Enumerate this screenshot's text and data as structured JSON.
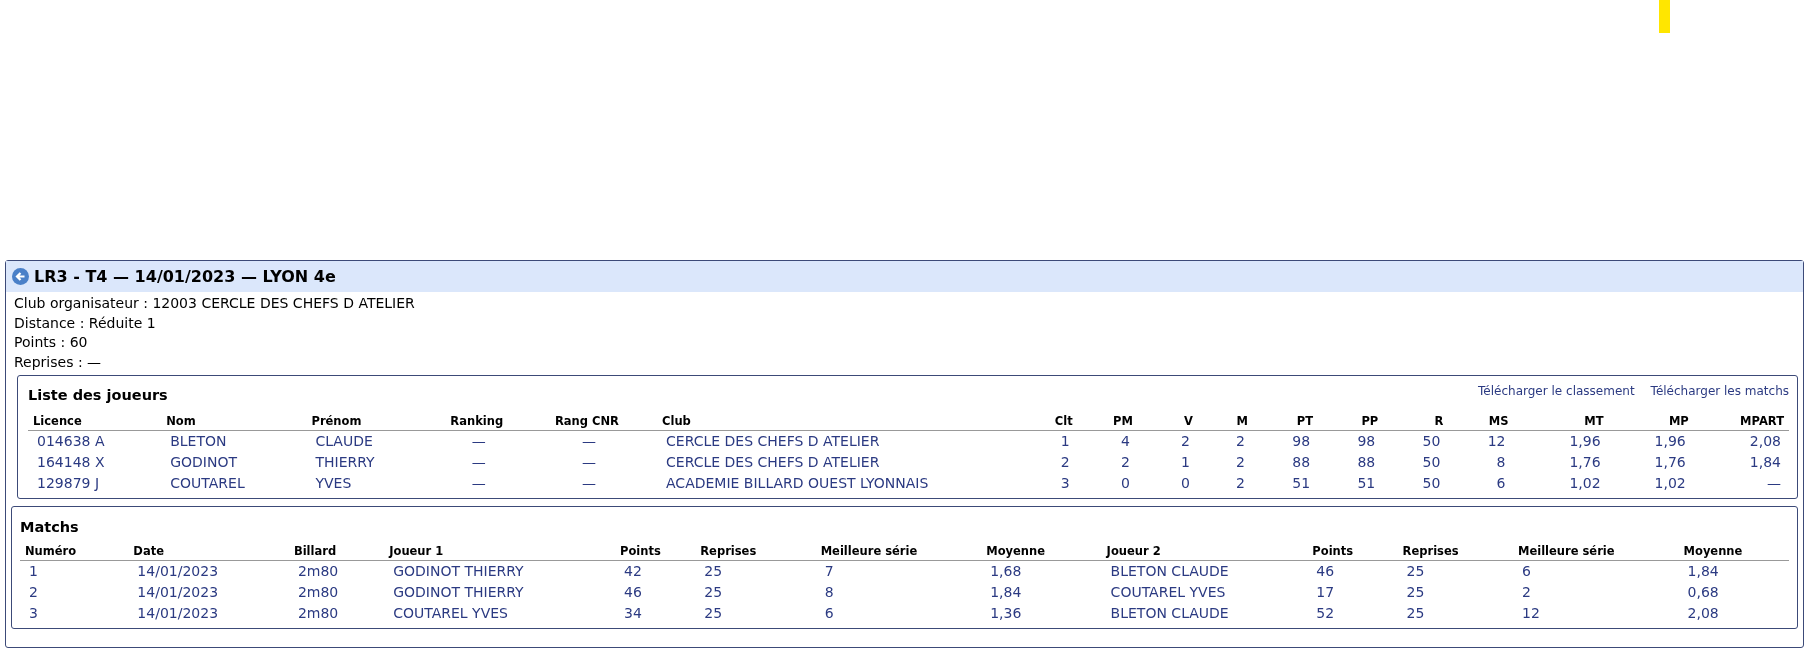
{
  "title": "LR3 - T4 — 14/01/2023 — LYON 4e",
  "info": [
    "Club organisateur : 12003 CERCLE DES CHEFS D ATELIER",
    "Distance : Réduite 1",
    "Points : 60",
    "Reprises : —"
  ],
  "players": {
    "title": "Liste des joueurs",
    "links": [
      "Télécharger le classement",
      "Télécharger les matchs"
    ],
    "columns": [
      "Licence",
      "Nom",
      "Prénom",
      "Ranking",
      "Rang CNR",
      "Club",
      "Clt",
      "PM",
      "V",
      "M",
      "PT",
      "PP",
      "R",
      "MS",
      "MT",
      "MP",
      "MPART"
    ],
    "rows": [
      [
        "014638 A",
        "BLETON",
        "CLAUDE",
        "—",
        "—",
        "CERCLE DES CHEFS D ATELIER",
        "1",
        "4",
        "2",
        "2",
        "98",
        "98",
        "50",
        "12",
        "1,96",
        "1,96",
        "2,08"
      ],
      [
        "164148 X",
        "GODINOT",
        "THIERRY",
        "—",
        "—",
        "CERCLE DES CHEFS D ATELIER",
        "2",
        "2",
        "1",
        "2",
        "88",
        "88",
        "50",
        "8",
        "1,76",
        "1,76",
        "1,84"
      ],
      [
        "129879 J",
        "COUTAREL",
        "YVES",
        "—",
        "—",
        "ACADEMIE BILLARD OUEST LYONNAIS",
        "3",
        "0",
        "0",
        "2",
        "51",
        "51",
        "50",
        "6",
        "1,02",
        "1,02",
        "—"
      ]
    ]
  },
  "matches": {
    "title": "Matchs",
    "columns": [
      "Numéro",
      "Date",
      "Billard",
      "Joueur 1",
      "Points",
      "Reprises",
      "Meilleure série",
      "Moyenne",
      "Joueur 2",
      "Points",
      "Reprises",
      "Meilleure série",
      "Moyenne"
    ],
    "rows": [
      [
        "1",
        "14/01/2023",
        "2m80",
        "GODINOT THIERRY",
        "42",
        "25",
        "7",
        "1,68",
        "BLETON CLAUDE",
        "46",
        "25",
        "6",
        "1,84"
      ],
      [
        "2",
        "14/01/2023",
        "2m80",
        "GODINOT THIERRY",
        "46",
        "25",
        "8",
        "1,84",
        "COUTAREL YVES",
        "17",
        "25",
        "2",
        "0,68"
      ],
      [
        "3",
        "14/01/2023",
        "2m80",
        "COUTAREL YVES",
        "34",
        "25",
        "6",
        "1,36",
        "BLETON CLAUDE",
        "52",
        "25",
        "12",
        "2,08"
      ]
    ]
  }
}
